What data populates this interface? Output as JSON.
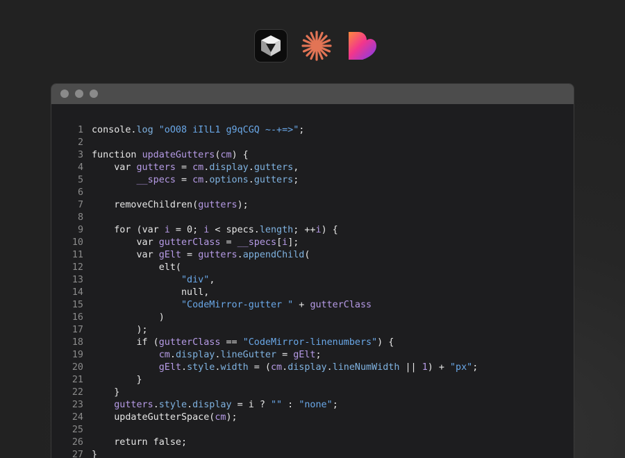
{
  "app_icons": [
    {
      "name": "cube-app-icon"
    },
    {
      "name": "sunburst-app-icon"
    },
    {
      "name": "heart-app-icon"
    }
  ],
  "window": {
    "controls": [
      "close-dot",
      "minimize-dot",
      "zoom-dot"
    ],
    "colors": {
      "background": "#1d1d1f",
      "titlebar": "#4c4c4c",
      "line_number": "#8b8b8b",
      "text": "#e6e6e6",
      "property": "#7fb2e0",
      "string": "#6aa8e8",
      "variable": "#b69be6"
    },
    "lines": [
      {
        "n": "1",
        "tokens": [
          [
            "plain",
            "console."
          ],
          [
            "prop",
            "log"
          ],
          [
            "plain",
            " "
          ],
          [
            "str",
            "\"oO08 iIlL1 g9qCGQ ~-+=>\""
          ],
          [
            "plain",
            ";"
          ]
        ]
      },
      {
        "n": "2",
        "tokens": []
      },
      {
        "n": "3",
        "tokens": [
          [
            "kw",
            "function"
          ],
          [
            "plain",
            " "
          ],
          [
            "var",
            "updateGutters"
          ],
          [
            "plain",
            "("
          ],
          [
            "var",
            "cm"
          ],
          [
            "plain",
            ") {"
          ]
        ]
      },
      {
        "n": "4",
        "tokens": [
          [
            "plain",
            "    "
          ],
          [
            "kw",
            "var"
          ],
          [
            "plain",
            " "
          ],
          [
            "var",
            "gutters"
          ],
          [
            "plain",
            " = "
          ],
          [
            "var",
            "cm"
          ],
          [
            "plain",
            "."
          ],
          [
            "prop",
            "display"
          ],
          [
            "plain",
            "."
          ],
          [
            "prop",
            "gutters"
          ],
          [
            "plain",
            ","
          ]
        ]
      },
      {
        "n": "5",
        "tokens": [
          [
            "plain",
            "        "
          ],
          [
            "var",
            "__specs"
          ],
          [
            "plain",
            " = "
          ],
          [
            "var",
            "cm"
          ],
          [
            "plain",
            "."
          ],
          [
            "prop",
            "options"
          ],
          [
            "plain",
            "."
          ],
          [
            "prop",
            "gutters"
          ],
          [
            "plain",
            ";"
          ]
        ]
      },
      {
        "n": "6",
        "tokens": []
      },
      {
        "n": "7",
        "tokens": [
          [
            "plain",
            "    removeChildren("
          ],
          [
            "var",
            "gutters"
          ],
          [
            "plain",
            ");"
          ]
        ]
      },
      {
        "n": "8",
        "tokens": []
      },
      {
        "n": "9",
        "tokens": [
          [
            "plain",
            "    "
          ],
          [
            "kw",
            "for"
          ],
          [
            "plain",
            " ("
          ],
          [
            "kw",
            "var"
          ],
          [
            "plain",
            " "
          ],
          [
            "var",
            "i"
          ],
          [
            "plain",
            " = 0; "
          ],
          [
            "var",
            "i"
          ],
          [
            "plain",
            " < specs."
          ],
          [
            "prop",
            "length"
          ],
          [
            "plain",
            "; ++"
          ],
          [
            "var",
            "i"
          ],
          [
            "plain",
            ") {"
          ]
        ]
      },
      {
        "n": "10",
        "tokens": [
          [
            "plain",
            "        "
          ],
          [
            "kw",
            "var"
          ],
          [
            "plain",
            " "
          ],
          [
            "var",
            "gutterClass"
          ],
          [
            "plain",
            " = "
          ],
          [
            "var",
            "__specs"
          ],
          [
            "plain",
            "["
          ],
          [
            "var",
            "i"
          ],
          [
            "plain",
            "];"
          ]
        ]
      },
      {
        "n": "11",
        "tokens": [
          [
            "plain",
            "        "
          ],
          [
            "kw",
            "var"
          ],
          [
            "plain",
            " "
          ],
          [
            "var",
            "gElt"
          ],
          [
            "plain",
            " = "
          ],
          [
            "var",
            "gutters"
          ],
          [
            "plain",
            "."
          ],
          [
            "prop",
            "appendChild"
          ],
          [
            "plain",
            "("
          ]
        ]
      },
      {
        "n": "12",
        "tokens": [
          [
            "plain",
            "            elt("
          ]
        ]
      },
      {
        "n": "13",
        "tokens": [
          [
            "plain",
            "                "
          ],
          [
            "str",
            "\"div\""
          ],
          [
            "plain",
            ","
          ]
        ]
      },
      {
        "n": "14",
        "tokens": [
          [
            "plain",
            "                null,"
          ]
        ]
      },
      {
        "n": "15",
        "tokens": [
          [
            "plain",
            "                "
          ],
          [
            "str",
            "\"CodeMirror-gutter \""
          ],
          [
            "plain",
            " + "
          ],
          [
            "var",
            "gutterClass"
          ]
        ]
      },
      {
        "n": "16",
        "tokens": [
          [
            "plain",
            "            )"
          ]
        ]
      },
      {
        "n": "17",
        "tokens": [
          [
            "plain",
            "        );"
          ]
        ]
      },
      {
        "n": "18",
        "tokens": [
          [
            "plain",
            "        "
          ],
          [
            "kw",
            "if"
          ],
          [
            "plain",
            " ("
          ],
          [
            "var",
            "gutterClass"
          ],
          [
            "plain",
            " == "
          ],
          [
            "str",
            "\"CodeMirror-linenumbers\""
          ],
          [
            "plain",
            ") {"
          ]
        ]
      },
      {
        "n": "19",
        "tokens": [
          [
            "plain",
            "            "
          ],
          [
            "var",
            "cm"
          ],
          [
            "plain",
            "."
          ],
          [
            "prop",
            "display"
          ],
          [
            "plain",
            "."
          ],
          [
            "prop",
            "lineGutter"
          ],
          [
            "plain",
            " = "
          ],
          [
            "var",
            "gElt"
          ],
          [
            "plain",
            ";"
          ]
        ]
      },
      {
        "n": "20",
        "tokens": [
          [
            "plain",
            "            "
          ],
          [
            "var",
            "gElt"
          ],
          [
            "plain",
            "."
          ],
          [
            "prop",
            "style"
          ],
          [
            "plain",
            "."
          ],
          [
            "prop",
            "width"
          ],
          [
            "plain",
            " = ("
          ],
          [
            "var",
            "cm"
          ],
          [
            "plain",
            "."
          ],
          [
            "prop",
            "display"
          ],
          [
            "plain",
            "."
          ],
          [
            "prop",
            "lineNumWidth"
          ],
          [
            "plain",
            " || "
          ],
          [
            "num",
            "1"
          ],
          [
            "plain",
            ") + "
          ],
          [
            "str",
            "\"px\""
          ],
          [
            "plain",
            ";"
          ]
        ]
      },
      {
        "n": "21",
        "tokens": [
          [
            "plain",
            "        }"
          ]
        ]
      },
      {
        "n": "22",
        "tokens": [
          [
            "plain",
            "    }"
          ]
        ]
      },
      {
        "n": "23",
        "tokens": [
          [
            "plain",
            "    "
          ],
          [
            "var",
            "gutters"
          ],
          [
            "plain",
            "."
          ],
          [
            "prop",
            "style"
          ],
          [
            "plain",
            "."
          ],
          [
            "prop",
            "display"
          ],
          [
            "plain",
            " = i ? "
          ],
          [
            "str",
            "\"\""
          ],
          [
            "plain",
            " : "
          ],
          [
            "str",
            "\"none\""
          ],
          [
            "plain",
            ";"
          ]
        ]
      },
      {
        "n": "24",
        "tokens": [
          [
            "plain",
            "    updateGutterSpace("
          ],
          [
            "var",
            "cm"
          ],
          [
            "plain",
            ");"
          ]
        ]
      },
      {
        "n": "25",
        "tokens": []
      },
      {
        "n": "26",
        "tokens": [
          [
            "plain",
            "    "
          ],
          [
            "kw",
            "return"
          ],
          [
            "plain",
            " false;"
          ]
        ]
      },
      {
        "n": "27",
        "tokens": [
          [
            "plain",
            "}"
          ]
        ]
      }
    ]
  }
}
